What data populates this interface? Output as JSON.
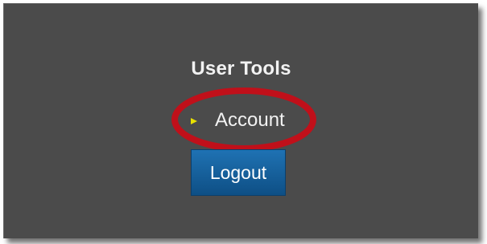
{
  "user_tools": {
    "title": "User Tools",
    "account_label": "Account",
    "logout_label": "Logout"
  },
  "icons": {
    "arrow": "arrow-right-icon",
    "highlight": "highlight-ellipse"
  },
  "colors": {
    "panel_background": "#4b4b4b",
    "text": "#f2f2f2",
    "arrow": "#e8e000",
    "highlight_ring": "#c0101a",
    "button_top": "#1f72b3",
    "button_bottom": "#0e4f85"
  }
}
